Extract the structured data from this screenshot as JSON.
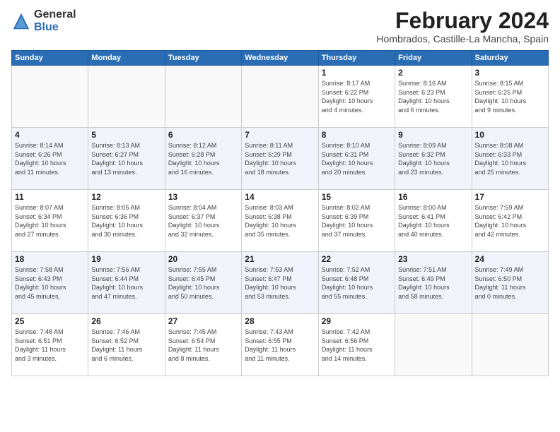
{
  "header": {
    "logo_general": "General",
    "logo_blue": "Blue",
    "month_title": "February 2024",
    "location": "Hombrados, Castille-La Mancha, Spain"
  },
  "days_of_week": [
    "Sunday",
    "Monday",
    "Tuesday",
    "Wednesday",
    "Thursday",
    "Friday",
    "Saturday"
  ],
  "weeks": [
    {
      "alt": false,
      "days": [
        {
          "num": "",
          "info": ""
        },
        {
          "num": "",
          "info": ""
        },
        {
          "num": "",
          "info": ""
        },
        {
          "num": "",
          "info": ""
        },
        {
          "num": "1",
          "info": "Sunrise: 8:17 AM\nSunset: 6:22 PM\nDaylight: 10 hours\nand 4 minutes."
        },
        {
          "num": "2",
          "info": "Sunrise: 8:16 AM\nSunset: 6:23 PM\nDaylight: 10 hours\nand 6 minutes."
        },
        {
          "num": "3",
          "info": "Sunrise: 8:15 AM\nSunset: 6:25 PM\nDaylight: 10 hours\nand 9 minutes."
        }
      ]
    },
    {
      "alt": true,
      "days": [
        {
          "num": "4",
          "info": "Sunrise: 8:14 AM\nSunset: 6:26 PM\nDaylight: 10 hours\nand 11 minutes."
        },
        {
          "num": "5",
          "info": "Sunrise: 8:13 AM\nSunset: 6:27 PM\nDaylight: 10 hours\nand 13 minutes."
        },
        {
          "num": "6",
          "info": "Sunrise: 8:12 AM\nSunset: 6:28 PM\nDaylight: 10 hours\nand 16 minutes."
        },
        {
          "num": "7",
          "info": "Sunrise: 8:11 AM\nSunset: 6:29 PM\nDaylight: 10 hours\nand 18 minutes."
        },
        {
          "num": "8",
          "info": "Sunrise: 8:10 AM\nSunset: 6:31 PM\nDaylight: 10 hours\nand 20 minutes."
        },
        {
          "num": "9",
          "info": "Sunrise: 8:09 AM\nSunset: 6:32 PM\nDaylight: 10 hours\nand 23 minutes."
        },
        {
          "num": "10",
          "info": "Sunrise: 8:08 AM\nSunset: 6:33 PM\nDaylight: 10 hours\nand 25 minutes."
        }
      ]
    },
    {
      "alt": false,
      "days": [
        {
          "num": "11",
          "info": "Sunrise: 8:07 AM\nSunset: 6:34 PM\nDaylight: 10 hours\nand 27 minutes."
        },
        {
          "num": "12",
          "info": "Sunrise: 8:05 AM\nSunset: 6:36 PM\nDaylight: 10 hours\nand 30 minutes."
        },
        {
          "num": "13",
          "info": "Sunrise: 8:04 AM\nSunset: 6:37 PM\nDaylight: 10 hours\nand 32 minutes."
        },
        {
          "num": "14",
          "info": "Sunrise: 8:03 AM\nSunset: 6:38 PM\nDaylight: 10 hours\nand 35 minutes."
        },
        {
          "num": "15",
          "info": "Sunrise: 8:02 AM\nSunset: 6:39 PM\nDaylight: 10 hours\nand 37 minutes."
        },
        {
          "num": "16",
          "info": "Sunrise: 8:00 AM\nSunset: 6:41 PM\nDaylight: 10 hours\nand 40 minutes."
        },
        {
          "num": "17",
          "info": "Sunrise: 7:59 AM\nSunset: 6:42 PM\nDaylight: 10 hours\nand 42 minutes."
        }
      ]
    },
    {
      "alt": true,
      "days": [
        {
          "num": "18",
          "info": "Sunrise: 7:58 AM\nSunset: 6:43 PM\nDaylight: 10 hours\nand 45 minutes."
        },
        {
          "num": "19",
          "info": "Sunrise: 7:56 AM\nSunset: 6:44 PM\nDaylight: 10 hours\nand 47 minutes."
        },
        {
          "num": "20",
          "info": "Sunrise: 7:55 AM\nSunset: 6:45 PM\nDaylight: 10 hours\nand 50 minutes."
        },
        {
          "num": "21",
          "info": "Sunrise: 7:53 AM\nSunset: 6:47 PM\nDaylight: 10 hours\nand 53 minutes."
        },
        {
          "num": "22",
          "info": "Sunrise: 7:52 AM\nSunset: 6:48 PM\nDaylight: 10 hours\nand 55 minutes."
        },
        {
          "num": "23",
          "info": "Sunrise: 7:51 AM\nSunset: 6:49 PM\nDaylight: 10 hours\nand 58 minutes."
        },
        {
          "num": "24",
          "info": "Sunrise: 7:49 AM\nSunset: 6:50 PM\nDaylight: 11 hours\nand 0 minutes."
        }
      ]
    },
    {
      "alt": false,
      "days": [
        {
          "num": "25",
          "info": "Sunrise: 7:48 AM\nSunset: 6:51 PM\nDaylight: 11 hours\nand 3 minutes."
        },
        {
          "num": "26",
          "info": "Sunrise: 7:46 AM\nSunset: 6:52 PM\nDaylight: 11 hours\nand 6 minutes."
        },
        {
          "num": "27",
          "info": "Sunrise: 7:45 AM\nSunset: 6:54 PM\nDaylight: 11 hours\nand 8 minutes."
        },
        {
          "num": "28",
          "info": "Sunrise: 7:43 AM\nSunset: 6:55 PM\nDaylight: 11 hours\nand 11 minutes."
        },
        {
          "num": "29",
          "info": "Sunrise: 7:42 AM\nSunset: 6:56 PM\nDaylight: 11 hours\nand 14 minutes."
        },
        {
          "num": "",
          "info": ""
        },
        {
          "num": "",
          "info": ""
        }
      ]
    }
  ]
}
